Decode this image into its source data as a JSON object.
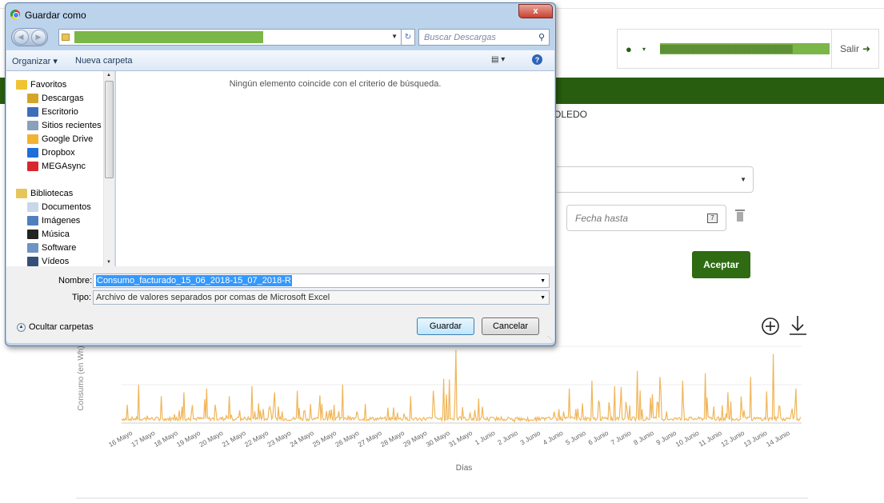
{
  "header": {
    "user_caret": "▾",
    "user_name": "██████████████████████████",
    "logout_label": "Salir"
  },
  "location_text": "OLEDO",
  "date_to_placeholder": "Fecha hasta",
  "calendar_icon_glyph": "7",
  "accept_label": "Aceptar",
  "chart_data": {
    "type": "line",
    "title": "",
    "xlabel": "Días",
    "ylabel": "Consumo (en Wh)",
    "color": "#f0b65a",
    "x": [
      "16 Mayo",
      "17 Mayo",
      "18 Mayo",
      "19 Mayo",
      "20 Mayo",
      "21 Mayo",
      "22 Mayo",
      "23 Mayo",
      "24 Mayo",
      "25 Mayo",
      "26 Mayo",
      "27 Mayo",
      "28 Mayo",
      "29 Mayo",
      "30 Mayo",
      "31 Mayo",
      "1 Junio",
      "2 Junio",
      "3 Junio",
      "4 Junio",
      "5 Junio",
      "6 Junio",
      "7 Junio",
      "8 Junio",
      "9 Junio",
      "10 Junio",
      "11 Junio",
      "12 Junio",
      "13 Junio",
      "14 Junio"
    ],
    "peaks": [
      0.5,
      0.35,
      0.4,
      0.45,
      0.35,
      0.48,
      0.4,
      0.42,
      0.36,
      0.5,
      0.25,
      0.2,
      0.35,
      0.42,
      0.95,
      0.32,
      0.08,
      0.05,
      0.06,
      0.45,
      0.55,
      0.48,
      0.68,
      0.6,
      0.55,
      0.65,
      0.4,
      0.6,
      0.9,
      0.45
    ],
    "grid": true
  },
  "dialog": {
    "title": "Guardar como",
    "close_glyph": "x",
    "address_path": "",
    "search_placeholder": "Buscar Descargas",
    "organize_label": "Organizar ▾",
    "new_folder_label": "Nueva carpeta",
    "help_glyph": "?",
    "views_glyph": "▤ ▾",
    "empty_message": "Ningún elemento coincide con el criterio de búsqueda.",
    "nav_items": [
      {
        "label": "Favoritos",
        "color": "#f1c232"
      },
      {
        "label": "Descargas",
        "color": "#d4a52a"
      },
      {
        "label": "Escritorio",
        "color": "#3d6fb8"
      },
      {
        "label": "Sitios recientes",
        "color": "#8aa0bb"
      },
      {
        "label": "Google Drive",
        "color": "#f2b233"
      },
      {
        "label": "Dropbox",
        "color": "#1e6fd9"
      },
      {
        "label": "MEGAsync",
        "color": "#d9272e"
      },
      {
        "label": "Bibliotecas",
        "color": "#e6c65a"
      },
      {
        "label": "Documentos",
        "color": "#c9d7ea"
      },
      {
        "label": "Imágenes",
        "color": "#4f7fbf"
      },
      {
        "label": "Música",
        "color": "#222222"
      },
      {
        "label": "Software",
        "color": "#6f93c4"
      },
      {
        "label": "Vídeos",
        "color": "#34507a"
      }
    ],
    "filename_label": "Nombre:",
    "filename_value": "Consumo_facturado_15_06_2018-15_07_2018-R",
    "filetype_label": "Tipo:",
    "filetype_value": "Archivo de valores separados por comas de Microsoft Excel",
    "hide_folders_label": "Ocultar carpetas",
    "save_label": "Guardar",
    "cancel_label": "Cancelar"
  }
}
